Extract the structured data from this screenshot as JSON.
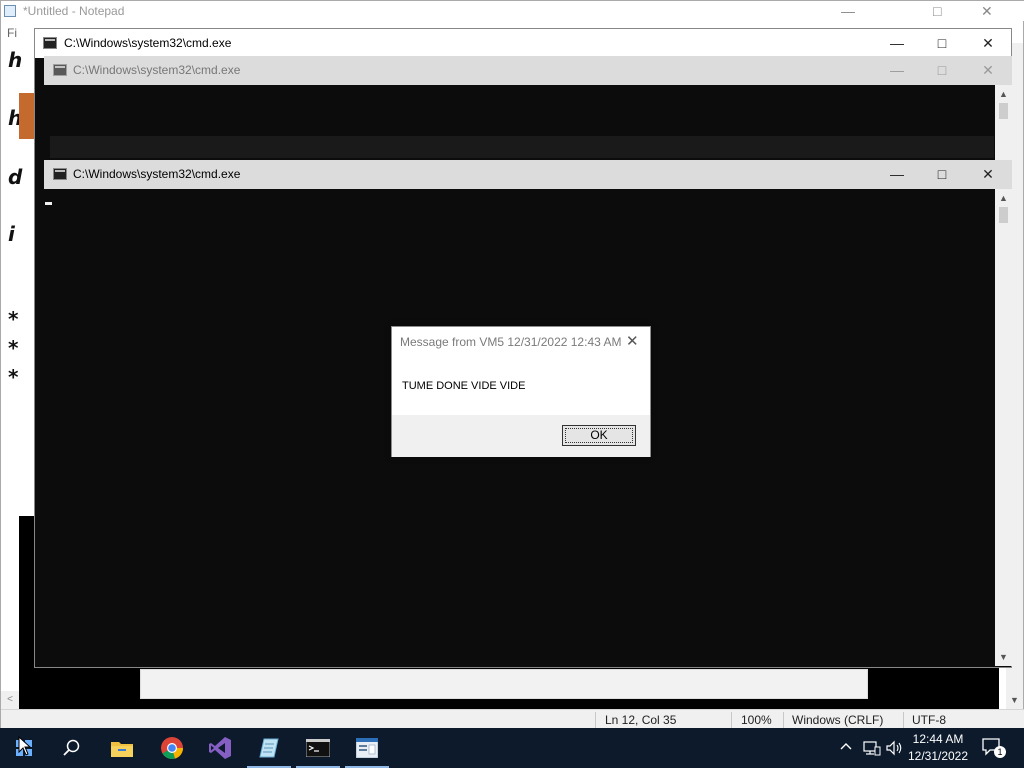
{
  "notepad": {
    "title": "*Untitled - Notepad",
    "menu_file": "Fi",
    "text_lines": [
      "h",
      "h",
      "d",
      "i",
      "*",
      "*",
      "*"
    ],
    "status": {
      "position": "Ln 12, Col 35",
      "zoom": "100%",
      "line_ending": "Windows (CRLF)",
      "encoding": "UTF-8"
    }
  },
  "cmd_windows": [
    {
      "title": "C:\\Windows\\system32\\cmd.exe",
      "state": "back"
    },
    {
      "title": "C:\\Windows\\system32\\cmd.exe",
      "state": "inactive"
    },
    {
      "title": "C:\\Windows\\system32\\cmd.exe",
      "state": "active"
    }
  ],
  "message_box": {
    "title": "Message from VM5 12/31/2022 12:43 AM",
    "message": "TUME DONE VIDE VIDE",
    "ok_label": "OK"
  },
  "taskbar": {
    "apps": [
      "start-icon",
      "search-icon",
      "file-explorer-icon",
      "chrome-icon",
      "visual-studio-icon",
      "notepad-icon",
      "cmd-icon",
      "document-icon"
    ],
    "time": "12:44 AM",
    "date": "12/31/2022",
    "notification_count": "1"
  },
  "colors": {
    "taskbar_bg": "#0d1a2c",
    "console_bg": "#0c0c0c",
    "accent_orange": "#c46a2f"
  }
}
